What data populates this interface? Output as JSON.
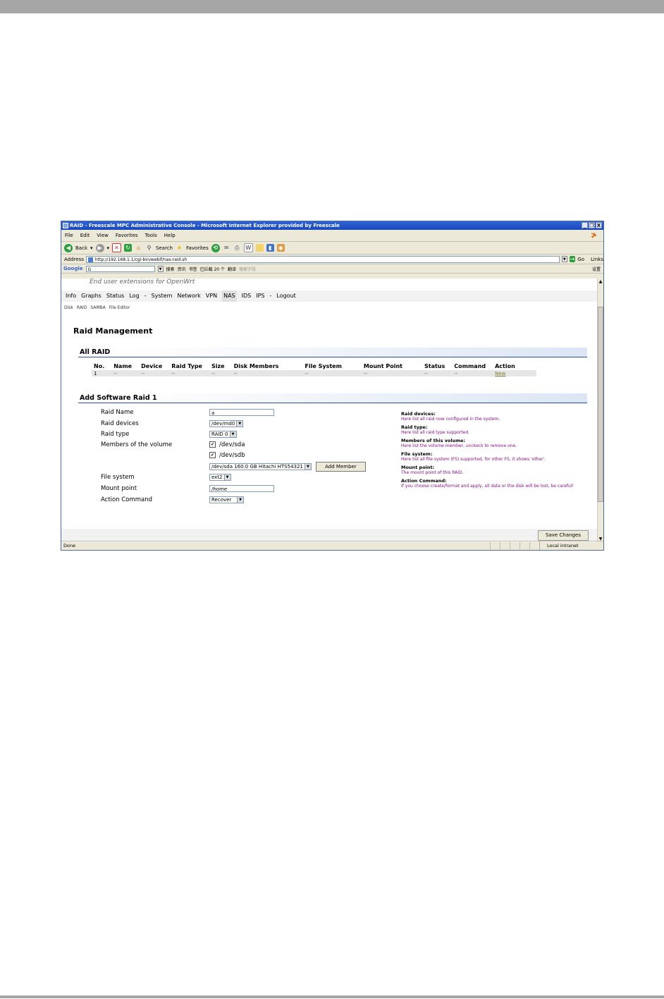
{
  "window": {
    "title": "RAID - Freescale MPC Administrative Console - Microsoft Internet Explorer provided by Freescale",
    "buttons": [
      "_",
      "❐",
      "X"
    ]
  },
  "menubar": [
    "File",
    "Edit",
    "View",
    "Favorites",
    "Tools",
    "Help"
  ],
  "toolbar": {
    "back": "Back",
    "search": "Search",
    "favorites": "Favorites"
  },
  "address": {
    "label": "Address",
    "url": "http://192.168.1.1/cgi-bin/webif/nas-raid.sh",
    "go": "Go",
    "links": "Links"
  },
  "googlebar": {
    "brand": "Google",
    "search_text": "G",
    "items": [
      "搜索",
      "资讯",
      "书签",
      "已拦截 20 个",
      "翻译",
      "搜索字段"
    ],
    "settings": "设置"
  },
  "page": {
    "tagline": "End user extensions for OpenWrt",
    "nav": [
      {
        "label": "Info"
      },
      {
        "label": "Graphs"
      },
      {
        "label": "Status"
      },
      {
        "label": "Log"
      },
      {
        "label": "-"
      },
      {
        "label": "System"
      },
      {
        "label": "Network"
      },
      {
        "label": "VPN"
      },
      {
        "label": "NAS"
      },
      {
        "label": "IDS"
      },
      {
        "label": "IPS"
      },
      {
        "label": "-"
      },
      {
        "label": "Logout"
      }
    ],
    "subnav": [
      "Disk",
      "RAID",
      "SAMBA",
      "File Editor"
    ],
    "title": "Raid Management",
    "all_raid": {
      "heading": "All RAID",
      "columns": [
        "No.",
        "Name",
        "Device",
        "Raid Type",
        "Size",
        "Disk Members",
        "File System",
        "Mount Point",
        "Status",
        "Command",
        "Action"
      ],
      "row": [
        "1",
        "--",
        "--",
        "--",
        "--",
        "--",
        "--",
        "--",
        "--",
        "--"
      ],
      "action": "New"
    },
    "add_raid": {
      "heading": "Add Software Raid 1",
      "labels": {
        "name": "Raid Name",
        "devices": "Raid devices",
        "type": "Raid type",
        "members": "Members of the volume",
        "fs": "File system",
        "mount": "Mount point",
        "command": "Action Command"
      },
      "values": {
        "name": "a",
        "devices": "/dev/md0",
        "type": "RAID 0",
        "member1": "/dev/sda",
        "member2": "/dev/sdb",
        "disk_select": "/dev/sda  160.0 GB Hitachi HTS54321",
        "add_member": "Add Member",
        "fs": "ext2",
        "mount": "/home",
        "command": "Recover"
      }
    },
    "help": [
      {
        "title": "Raid devices:",
        "text": "Here list all raid now configured in the system."
      },
      {
        "title": "Raid type:",
        "text": "Here list all raid type supported."
      },
      {
        "title": "Members of this volume:",
        "text": "Here list the volume member, unckeck to remove one."
      },
      {
        "title": "File system:",
        "text": "Here list all file system (FS) supported, for other FS, it shows 'other'."
      },
      {
        "title": "Mount point:",
        "text": "The mount point of this RAID."
      },
      {
        "title": "Action Command:",
        "text": "If you choose create/format and apply, all data or the disk will be lost, be careful!"
      }
    ],
    "save": "Save Changes"
  },
  "status": {
    "done": "Done",
    "zone": "Local intranet"
  }
}
